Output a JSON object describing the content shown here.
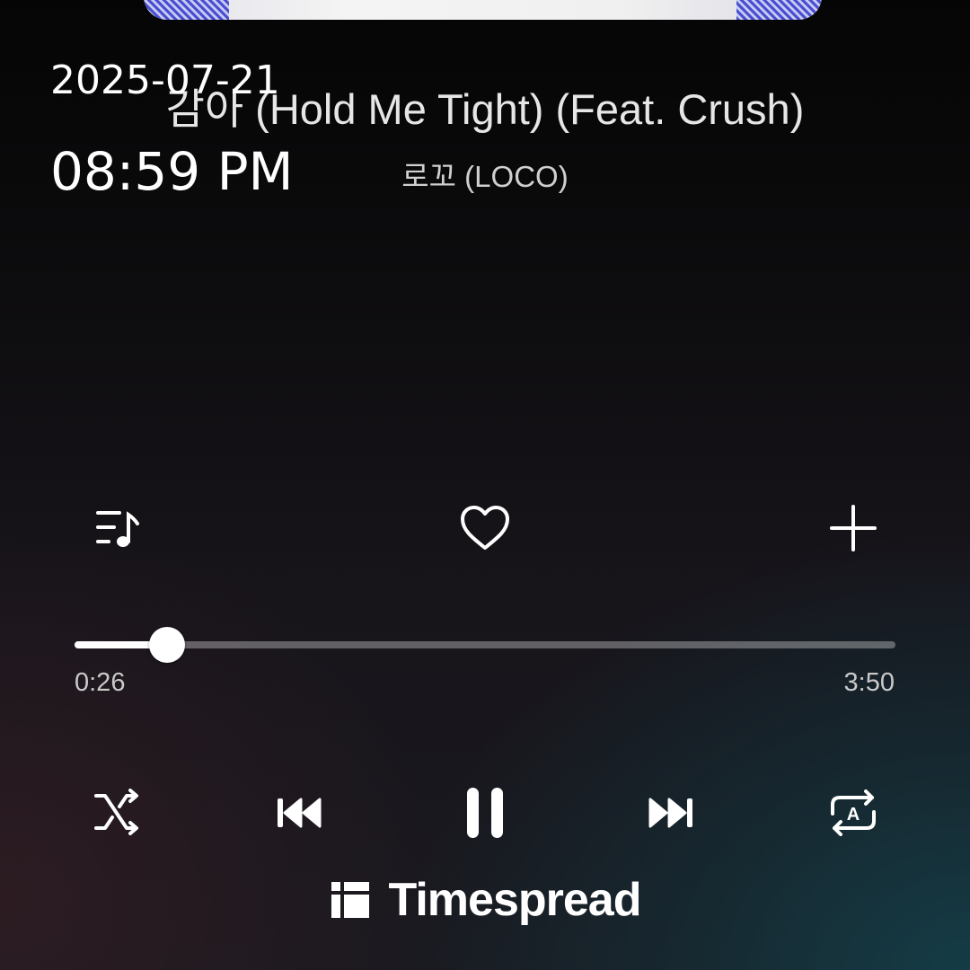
{
  "now_playing": {
    "title": "감아 (Hold Me Tight) (Feat. Crush)",
    "artist": "로꼬 (LOCO)"
  },
  "overlay": {
    "date": "2025-07-21",
    "time": "08:59 PM"
  },
  "actions": {
    "playlist_icon": "playlist-music-icon",
    "like_icon": "heart-outline-icon",
    "add_icon": "plus-icon"
  },
  "progress": {
    "elapsed": "0:26",
    "total": "3:50",
    "fraction": 0.113
  },
  "controls": {
    "shuffle_icon": "shuffle-icon",
    "previous_icon": "skip-previous-icon",
    "play_state": "playing",
    "pause_icon": "pause-icon",
    "next_icon": "skip-next-icon",
    "repeat_icon": "repeat-a-icon"
  },
  "watermark": {
    "brand": "Timespread"
  }
}
